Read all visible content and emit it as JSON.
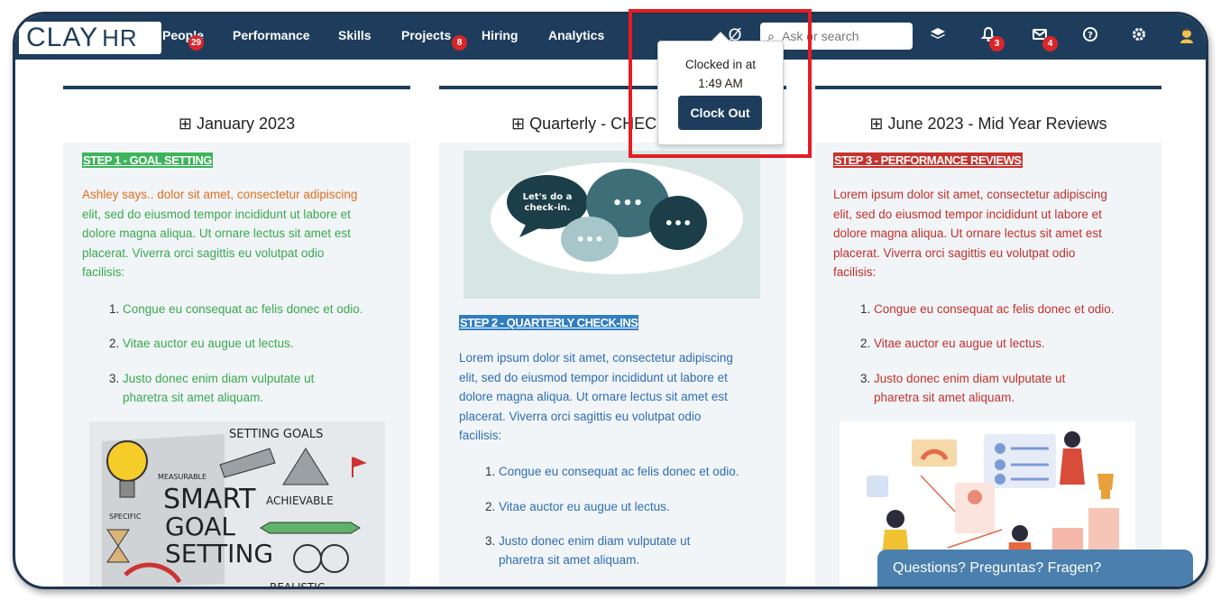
{
  "app": {
    "logo_main": "CLAY",
    "logo_hr": "HR"
  },
  "nav": {
    "items": [
      {
        "label": "People",
        "badge": "29"
      },
      {
        "label": "Performance"
      },
      {
        "label": "Skills"
      },
      {
        "label": "Projects",
        "badge": "8"
      },
      {
        "label": "Hiring"
      },
      {
        "label": "Analytics"
      }
    ],
    "timer_icon": "Ø",
    "search_placeholder": "Ask or search",
    "notifications_badge": "3",
    "messages_badge": "4"
  },
  "clock_popup": {
    "line1": "Clocked in at",
    "line2": "1:49 AM",
    "button": "Clock Out"
  },
  "columns": [
    {
      "title": "January 2023",
      "step": "STEP 1 - GOAL SETTING",
      "step_color": "#3cb55a",
      "text_color_intro": "#e46e1e",
      "text_color": "#3aa84f",
      "intro_name": "Ashley says..",
      "paragraph_lines": [
        "dolor sit amet, consectetur adipiscing",
        "elit, sed do eiusmod tempor incididunt ut labore et",
        "dolore magna aliqua. Ut ornare lectus sit amet est",
        "placerat. Viverra orci sagittis eu volutpat odio",
        "facilisis:"
      ],
      "list": [
        "Congue eu consequat ac felis donec et odio.",
        "Vitae auctor eu augue ut lectus.",
        "Justo donec enim diam vulputate ut",
        "pharetra sit amet aliquam."
      ],
      "image_text": [
        "SETTING GOALS",
        "MEASURABLE",
        "SMART",
        "ACHIEVABLE",
        "SPECIFIC",
        "GOAL",
        "SETTING",
        "REALISTIC"
      ]
    },
    {
      "title": "Quarterly - CHECK-INS",
      "step": "STEP 2 - QUARTERLY CHECK-INS",
      "step_color": "#2f7ec2",
      "text_color": "#2f6db3",
      "image_text": [
        "Let's do a",
        "check-in."
      ],
      "paragraph_lines": [
        "Lorem ipsum dolor sit amet, consectetur adipiscing",
        "elit, sed do eiusmod tempor incididunt ut labore et",
        "dolore magna aliqua. Ut ornare lectus sit amet est",
        "placerat. Viverra orci sagittis eu volutpat odio",
        "facilisis:"
      ],
      "list": [
        "Congue eu consequat ac felis donec et odio.",
        "Vitae auctor eu augue ut lectus.",
        "Justo donec enim diam vulputate ut",
        "pharetra sit amet aliquam."
      ]
    },
    {
      "title": "June 2023 - Mid Year Reviews",
      "step": "STEP 3 - PERFORMANCE REVIEWS",
      "step_color": "#c8322d",
      "text_color": "#c4302b",
      "paragraph_lines": [
        "Lorem ipsum dolor sit amet, consectetur adipiscing",
        "elit, sed do eiusmod tempor incididunt ut labore et",
        "dolore magna aliqua. Ut ornare lectus sit amet est",
        "placerat. Viverra orci sagittis eu volutpat odio",
        "facilisis:"
      ],
      "list": [
        "Congue eu consequat ac felis donec et odio.",
        "Vitae auctor eu augue ut lectus.",
        "Justo donec enim diam vulputate ut",
        "pharetra sit amet aliquam."
      ]
    }
  ],
  "chat_widget": {
    "label": "Questions? Preguntas? Fragen?"
  },
  "colors": {
    "nav_bg": "#1e3d5c",
    "badge": "#d9262a",
    "highlight": "#e51c23",
    "chat": "#4a7fae"
  }
}
